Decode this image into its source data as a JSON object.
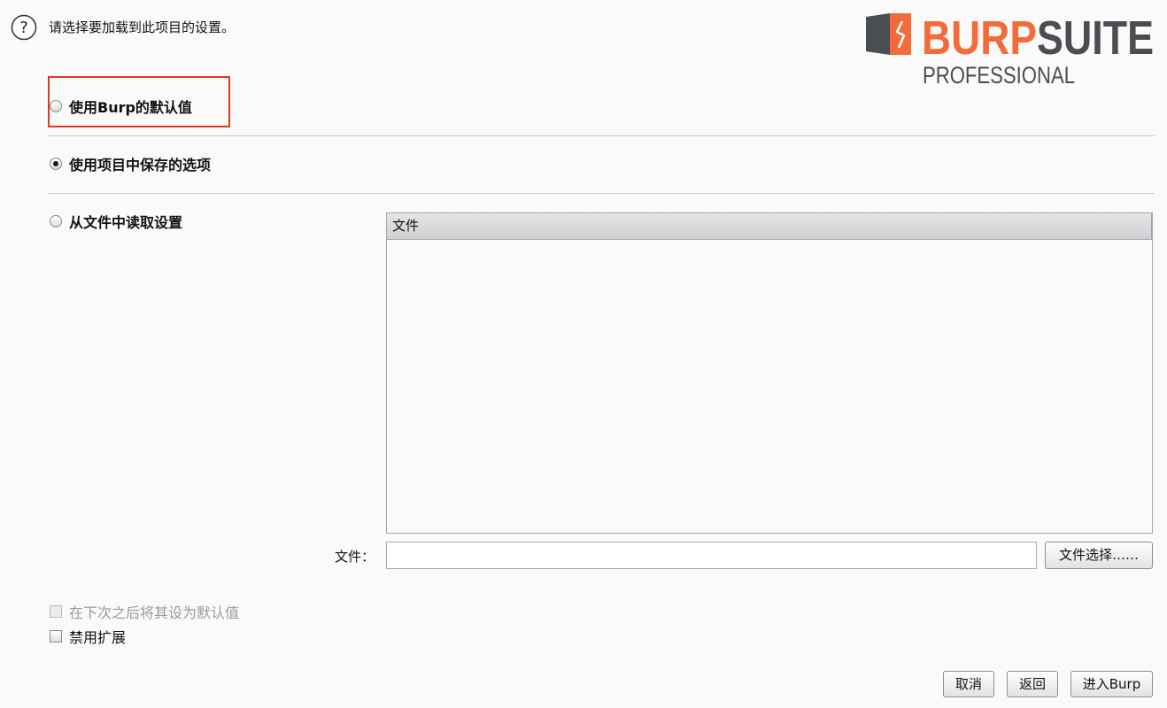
{
  "header": {
    "prompt": "请选择要加载到此项目的设置。",
    "help_icon": "question-mark-circle-icon"
  },
  "logo": {
    "brand": "BURPSUITE",
    "edition": "PROFESSIONAL",
    "brand_color": "#f36b3b",
    "gray_color": "#4a4d52"
  },
  "options": {
    "use_defaults": "使用Burp的默认值",
    "use_project_saved": "使用项目中保存的选项",
    "load_from_file": "从文件中读取设置",
    "selected": "use_project_saved"
  },
  "file_table": {
    "columns": [
      "文件"
    ],
    "rows": []
  },
  "file_field": {
    "label": "文件：",
    "value": "",
    "browse_label": "文件选择……"
  },
  "checkboxes": {
    "make_default": {
      "label": "在下次之后将其设为默认值",
      "checked": false,
      "enabled": false
    },
    "disable_extensions": {
      "label": "禁用扩展",
      "checked": false,
      "enabled": true
    }
  },
  "buttons": {
    "cancel": "取消",
    "back": "返回",
    "start": "进入Burp"
  },
  "highlight_color": "#e03a1e"
}
